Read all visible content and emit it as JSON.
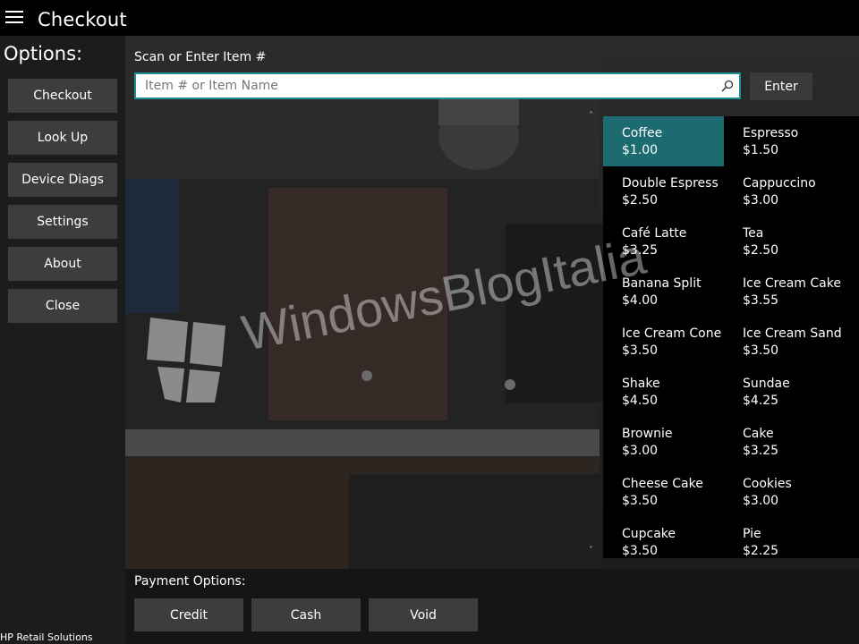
{
  "app": {
    "title": "Checkout"
  },
  "sidebar": {
    "heading": "Options:",
    "items": [
      {
        "label": "Checkout"
      },
      {
        "label": "Look Up"
      },
      {
        "label": "Device Diags"
      },
      {
        "label": "Settings"
      },
      {
        "label": "About"
      },
      {
        "label": "Close"
      }
    ],
    "footer": "HP Retail Solutions"
  },
  "scan": {
    "label": "Scan or Enter Item #",
    "placeholder": "Item # or Item Name",
    "value": "",
    "enter_label": "Enter"
  },
  "menu": {
    "selected": "Coffee",
    "items": [
      {
        "name": "Coffee",
        "price": "$1.00"
      },
      {
        "name": "Espresso",
        "price": "$1.50"
      },
      {
        "name": "Double Espress",
        "price": "$2.50"
      },
      {
        "name": "Cappuccino",
        "price": "$3.00"
      },
      {
        "name": "Café Latte",
        "price": "$3.25"
      },
      {
        "name": "Tea",
        "price": "$2.50"
      },
      {
        "name": "Banana Split",
        "price": "$4.00"
      },
      {
        "name": "Ice Cream Cake",
        "price": "$3.55"
      },
      {
        "name": "Ice Cream Cone",
        "price": "$3.50"
      },
      {
        "name": "Ice Cream Sand",
        "price": "$3.50"
      },
      {
        "name": "Shake",
        "price": "$4.50"
      },
      {
        "name": "Sundae",
        "price": "$4.25"
      },
      {
        "name": "Brownie",
        "price": "$3.00"
      },
      {
        "name": "Cake",
        "price": "$3.25"
      },
      {
        "name": "Cheese Cake",
        "price": "$3.50"
      },
      {
        "name": "Cookies",
        "price": "$3.00"
      },
      {
        "name": "Cupcake",
        "price": "$3.50"
      },
      {
        "name": "Pie",
        "price": "$2.25"
      }
    ]
  },
  "payment": {
    "label": "Payment Options:",
    "buttons": [
      {
        "label": "Credit"
      },
      {
        "label": "Cash"
      },
      {
        "label": "Void"
      }
    ]
  },
  "overlay": {
    "watermark": "WindowsBlogItalia"
  },
  "icons": {
    "menu": "hamburger-icon",
    "search": "search-icon",
    "up": "chevron-up-icon",
    "down": "chevron-down-icon"
  },
  "colors": {
    "accent": "#1c6b70",
    "border": "#1f8d97",
    "button": "#3d3d3d"
  }
}
